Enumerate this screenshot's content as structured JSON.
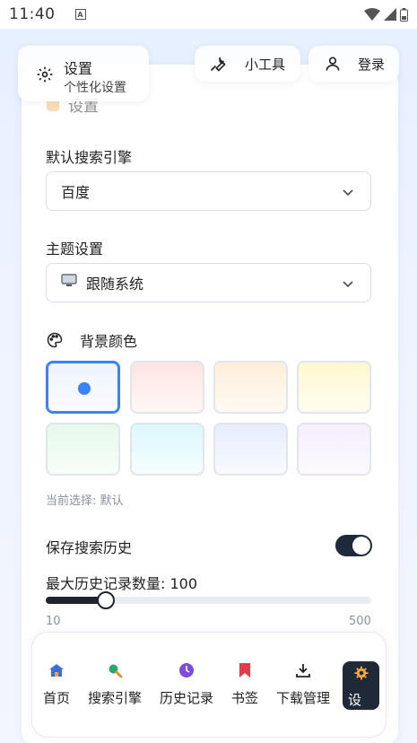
{
  "statusbar": {
    "time": "11:40"
  },
  "header": {
    "settings_title": "设置",
    "settings_subtitle": "个性化设置",
    "tools_label": "小工具",
    "login_label": "登录",
    "ghost_title": "设置"
  },
  "search_engine": {
    "label": "默认搜索引擎",
    "value": "百度"
  },
  "theme": {
    "label": "主题设置",
    "value": "跟随系统"
  },
  "background": {
    "label": "背景颜色",
    "swatches": [
      "#eef3ff",
      "#ffe3e3",
      "#ffeed9",
      "#fff8cf",
      "#e6f9ea",
      "#dcf8fd",
      "#e6edfd",
      "#f5eefe"
    ],
    "selected_index": 0,
    "current_text": "当前选择: 默认"
  },
  "history": {
    "save_label": "保存搜索历史",
    "save_enabled": true,
    "max_label": "最大历史记录数量: 100",
    "max_value": 100,
    "min": 10,
    "max": 500,
    "min_label": "10",
    "max_label_text": "500"
  },
  "bottom_nav": {
    "items": [
      {
        "label": "首页",
        "icon": "home-icon"
      },
      {
        "label": "搜索引擎",
        "icon": "search-icon"
      },
      {
        "label": "历史记录",
        "icon": "clock-icon"
      },
      {
        "label": "书签",
        "icon": "bookmark-icon"
      },
      {
        "label": "下载管理",
        "icon": "download-icon"
      },
      {
        "label": "设置",
        "icon": "gear-icon"
      }
    ],
    "active_index": 5
  },
  "colors": {
    "accent": "#3b82f6",
    "dark": "#1f2937"
  }
}
